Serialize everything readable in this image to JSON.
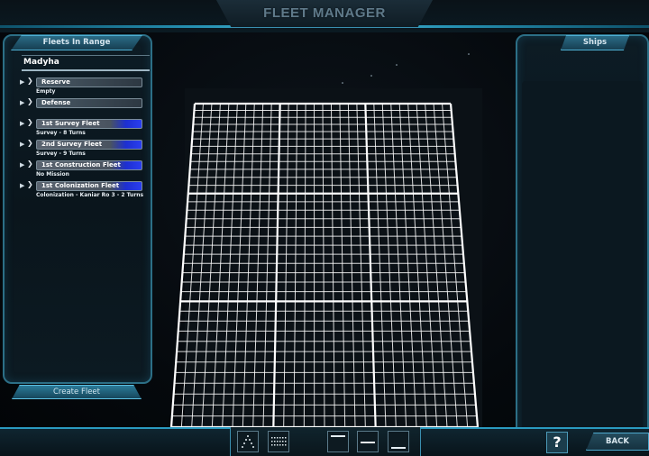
{
  "window": {
    "title": "FLEET MANAGER"
  },
  "left_panel": {
    "header": "Fleets In Range",
    "system_name": "Madyha",
    "fleets": [
      {
        "name": "Reserve",
        "mission": "Empty",
        "highlight": false
      },
      {
        "name": "Defense",
        "mission": "",
        "highlight": false
      },
      {
        "name": "1st Survey Fleet",
        "mission": "Survey - 8 Turns",
        "highlight": true
      },
      {
        "name": "2nd Survey Fleet",
        "mission": "Survey - 9 Turns",
        "highlight": true
      },
      {
        "name": "1st Construction Fleet",
        "mission": "No Mission",
        "highlight": true
      },
      {
        "name": "1st Colonization Fleet",
        "mission": "Colonization - Kaniar Ro 3 - 2 Turns",
        "highlight": true
      }
    ],
    "create_button": "Create Fleet"
  },
  "right_panel": {
    "header": "Ships"
  },
  "bottom_bar": {
    "tools": [
      {
        "icon": "triangle-formation-icon"
      },
      {
        "icon": "grid-formation-icon"
      },
      {
        "icon": "line-top-icon"
      },
      {
        "icon": "line-middle-icon"
      },
      {
        "icon": "line-bottom-icon"
      }
    ],
    "help_label": "?",
    "back_label": "BACK"
  },
  "colors": {
    "accent": "#2aa6cc",
    "panel_border": "#2c6f86",
    "highlight_blue": "#2a3ef0",
    "grid_line": "#ffffff"
  }
}
